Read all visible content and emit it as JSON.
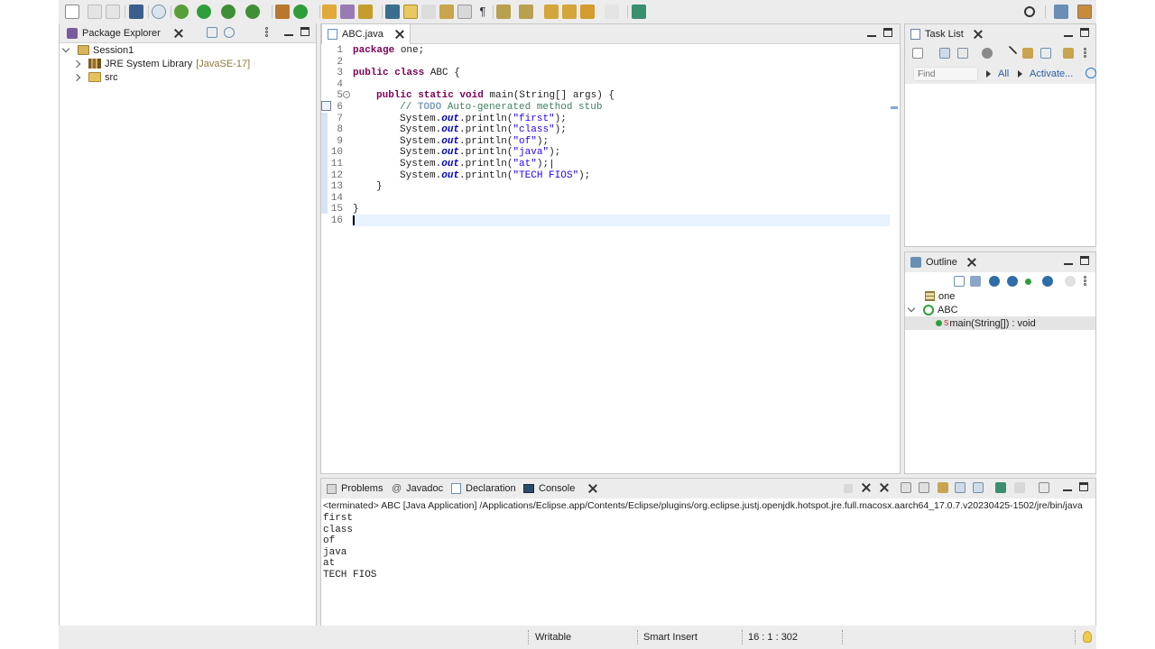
{
  "package_explorer": {
    "title": "Package Explorer",
    "tree": [
      {
        "label": "Session1",
        "decoration": ""
      },
      {
        "label": "JRE System Library",
        "decoration": "[JavaSE-17]"
      },
      {
        "label": "src",
        "decoration": ""
      }
    ]
  },
  "editor": {
    "tab_title": "ABC.java",
    "lines": [
      "1",
      "2",
      "3",
      "4",
      "5",
      "6",
      "7",
      "8",
      "9",
      "10",
      "11",
      "12",
      "13",
      "14",
      "15",
      "16"
    ],
    "code": {
      "l1_kw": "package",
      "l1_rest": " one;",
      "l3_kw": "public class",
      "l3_rest": " ABC {",
      "l5_kw": "public static void",
      "l5_rest": " main(String[] args) {",
      "l6_comment": "// ",
      "l6_todo": "TODO",
      "l6_rest": " Auto-generated method stub",
      "sys": "System.",
      "out": "out",
      "println": ".println(",
      "close": ");",
      "strings": [
        "\"first\"",
        "\"class\"",
        "\"of\"",
        "\"java\"",
        "\"at\"",
        "\"TECH FIOS\""
      ],
      "l13_brace": "}",
      "l15_brace": "}"
    }
  },
  "task_list": {
    "title": "Task List",
    "find_placeholder": "Find",
    "all_label": "All",
    "activate_label": "Activate..."
  },
  "outline": {
    "title": "Outline",
    "items": [
      {
        "label": "one"
      },
      {
        "label": "ABC"
      },
      {
        "label": "main(String[]) : void",
        "modifier": "S"
      }
    ]
  },
  "bottom_panel": {
    "tabs": [
      "Problems",
      "Javadoc",
      "Declaration",
      "Console"
    ],
    "terminated_line": "<terminated> ABC [Java Application] /Applications/Eclipse.app/Contents/Eclipse/plugins/org.eclipse.justj.openjdk.hotspot.jre.full.macosx.aarch64_17.0.7.v20230425-1502/jre/bin/java",
    "output": [
      "first",
      "class",
      "of",
      "java",
      "at",
      "TECH FIOS"
    ]
  },
  "status_bar": {
    "mode": "Writable",
    "insert": "Smart Insert",
    "position": "16 : 1 : 302"
  },
  "colors": {
    "keyword": "#7f0055",
    "string": "#2a00ff",
    "comment": "#3f7f5f",
    "field": "#0000c0",
    "run_green": "#2e9e3a",
    "debug_green": "#5a9e3a",
    "highlight_line": "#e8f2fe"
  }
}
